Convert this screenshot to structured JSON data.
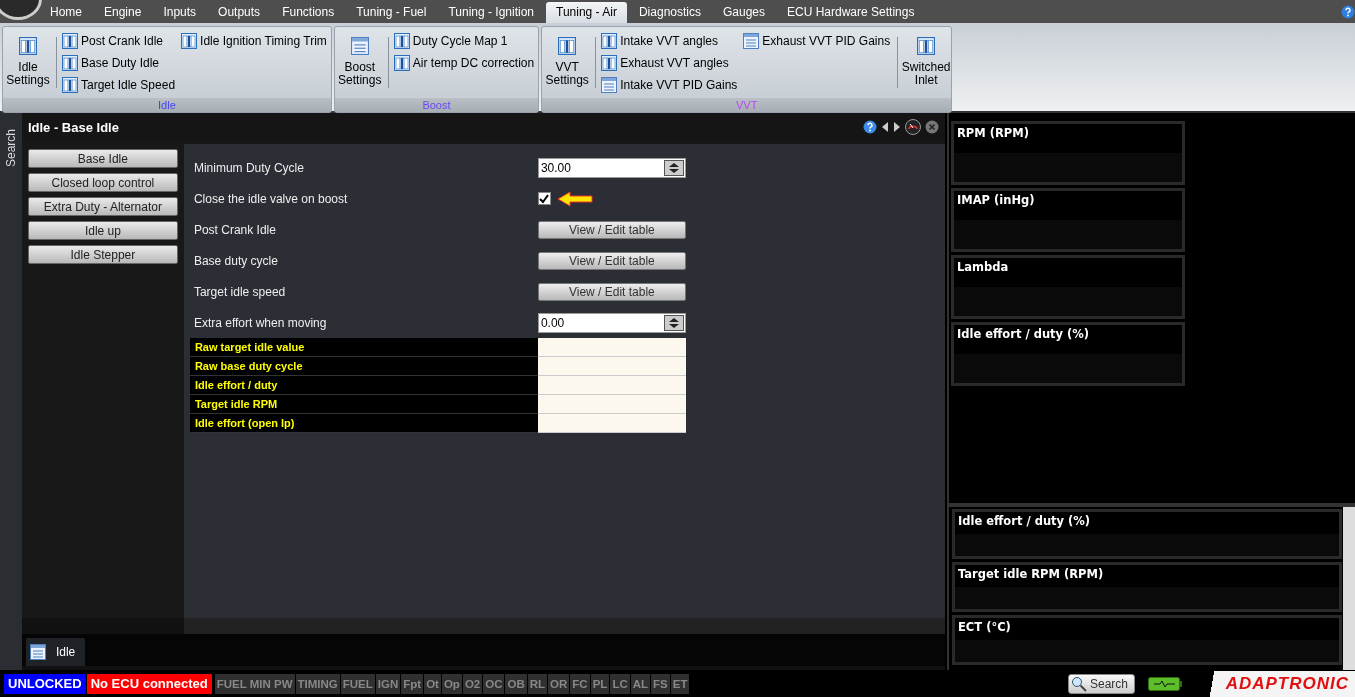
{
  "menu_tabs": [
    {
      "label": "Home",
      "selected": false
    },
    {
      "label": "Engine",
      "selected": false
    },
    {
      "label": "Inputs",
      "selected": false
    },
    {
      "label": "Outputs",
      "selected": false
    },
    {
      "label": "Functions",
      "selected": false
    },
    {
      "label": "Tuning - Fuel",
      "selected": false
    },
    {
      "label": "Tuning - Ignition",
      "selected": false
    },
    {
      "label": "Tuning - Air",
      "selected": true
    },
    {
      "label": "Diagnostics",
      "selected": false
    },
    {
      "label": "Gauges",
      "selected": false
    },
    {
      "label": "ECU Hardware Settings",
      "selected": false
    }
  ],
  "ribbon_groups": [
    {
      "label": "Idle",
      "color": "#4646f0",
      "parts": [
        {
          "kind": "large_table",
          "label": "Idle Settings"
        },
        {
          "kind": "columns",
          "columns": [
            [
              {
                "label": "Post Crank Idle",
                "kind": "table"
              },
              {
                "label": "Base Duty Idle",
                "kind": "table"
              },
              {
                "label": "Target Idle Speed",
                "kind": "table"
              }
            ],
            [
              {
                "label": "Idle Ignition Timing Trim",
                "kind": "table"
              }
            ]
          ]
        }
      ]
    },
    {
      "label": "Boost",
      "color": "#6a4af0",
      "parts": [
        {
          "kind": "large_list",
          "label": "Boost Settings"
        },
        {
          "kind": "columns",
          "columns": [
            [
              {
                "label": "Duty Cycle Map 1",
                "kind": "table"
              },
              {
                "label": "Air temp DC correction",
                "kind": "table"
              }
            ]
          ]
        }
      ]
    },
    {
      "label": "VVT",
      "color": "#b44af0",
      "parts": [
        {
          "kind": "large_table",
          "label": "VVT Settings"
        },
        {
          "kind": "columns",
          "columns": [
            [
              {
                "label": "Intake VVT angles",
                "kind": "table"
              },
              {
                "label": "Exhaust VVT angles",
                "kind": "table"
              },
              {
                "label": "Intake VVT PID Gains",
                "kind": "list"
              }
            ],
            [
              {
                "label": "Exhaust VVT PID Gains",
                "kind": "list"
              }
            ]
          ]
        },
        {
          "kind": "large_table",
          "label": "Switched Inlet"
        }
      ]
    }
  ],
  "side_tab": "Search",
  "panel": {
    "title": "Idle - Base Idle",
    "side_buttons": [
      "Base Idle",
      "Closed loop control",
      "Extra Duty - Alternator",
      "Idle up",
      "Idle Stepper"
    ],
    "settings": [
      {
        "kind": "number",
        "label": "Minimum Duty Cycle",
        "value": "30.00"
      },
      {
        "kind": "checkbox",
        "label": "Close the idle valve on boost",
        "checked": true
      },
      {
        "kind": "table",
        "label": "Post Crank Idle",
        "button": "View / Edit table"
      },
      {
        "kind": "table",
        "label": "Base duty cycle",
        "button": "View / Edit table"
      },
      {
        "kind": "table",
        "label": "Target idle speed",
        "button": "View / Edit table"
      },
      {
        "kind": "number",
        "label": "Extra effort when moving",
        "value": "0.00"
      }
    ],
    "readouts": [
      "Raw target idle value",
      "Raw base duty cycle",
      "Idle effort / duty",
      "Target idle RPM",
      "Idle effort (open lp)"
    ],
    "bottom_tab": "Idle"
  },
  "gauges_top": [
    "RPM (RPM)",
    "IMAP  (inHg)",
    "Lambda",
    "Idle effort / duty (%)"
  ],
  "gauges_bottom": [
    "Idle effort / duty (%)",
    "Target idle RPM (RPM)",
    "ECT (°C)"
  ],
  "status": {
    "badges": [
      {
        "label": "UNLOCKED",
        "color": "#0000ff"
      },
      {
        "label": "No ECU connected",
        "color": "#ff0000"
      }
    ],
    "flags": [
      "FUEL MIN PW",
      "TIMING",
      "FUEL",
      "IGN",
      "Fpt",
      "Ot",
      "Op",
      "O2",
      "OC",
      "OB",
      "RL",
      "OR",
      "FC",
      "PL",
      "LC",
      "AL",
      "FS",
      "ET"
    ],
    "search_button": "Search",
    "logo": "ADAPTRONIC"
  }
}
